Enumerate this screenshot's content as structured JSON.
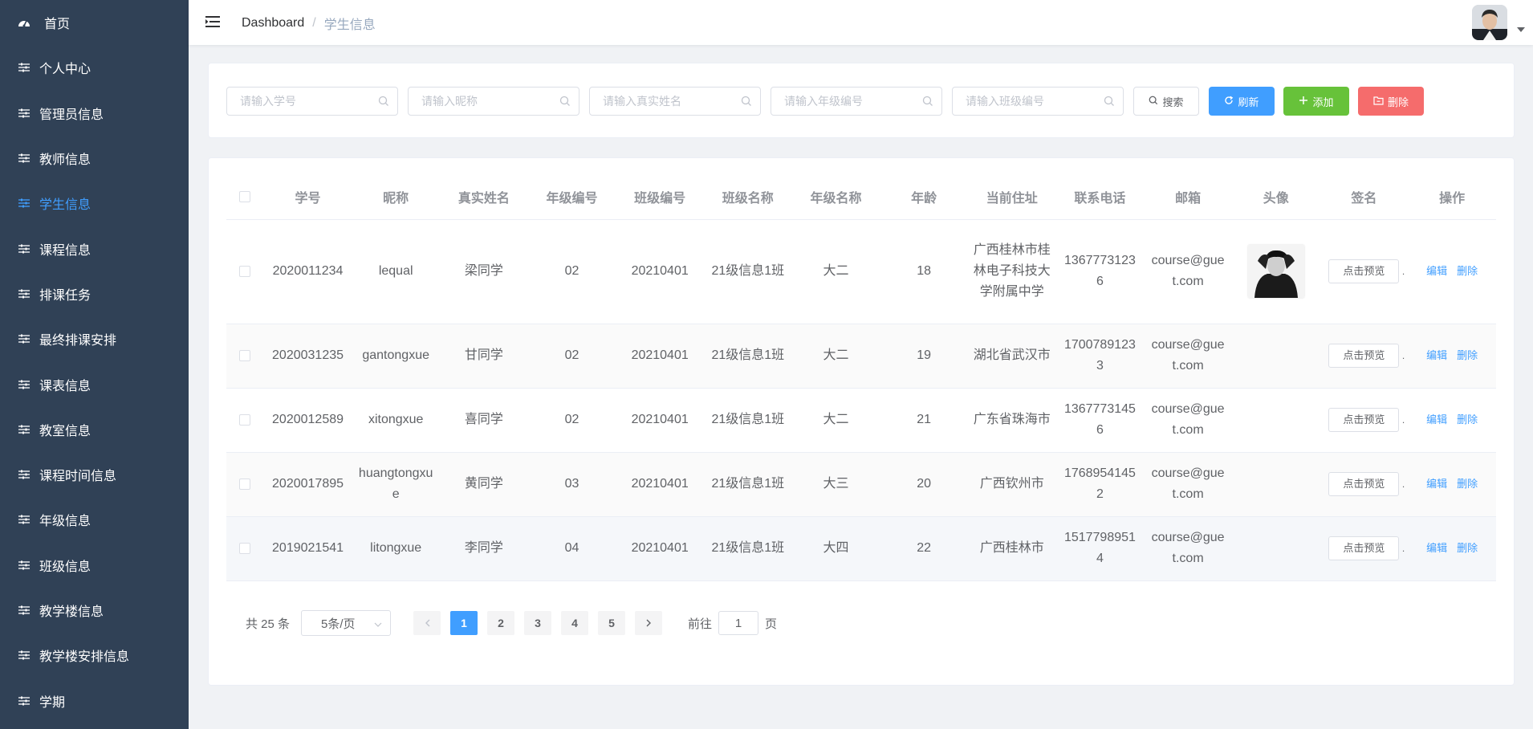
{
  "sidebar": {
    "items": [
      {
        "label": "首页",
        "icon": "dashboard-icon"
      },
      {
        "label": "个人中心",
        "icon": "sliders-icon"
      },
      {
        "label": "管理员信息",
        "icon": "sliders-icon"
      },
      {
        "label": "教师信息",
        "icon": "sliders-icon"
      },
      {
        "label": "学生信息",
        "icon": "sliders-icon",
        "active": true
      },
      {
        "label": "课程信息",
        "icon": "sliders-icon"
      },
      {
        "label": "排课任务",
        "icon": "sliders-icon"
      },
      {
        "label": "最终排课安排",
        "icon": "sliders-icon"
      },
      {
        "label": "课表信息",
        "icon": "sliders-icon"
      },
      {
        "label": "教室信息",
        "icon": "sliders-icon"
      },
      {
        "label": "课程时间信息",
        "icon": "sliders-icon"
      },
      {
        "label": "年级信息",
        "icon": "sliders-icon"
      },
      {
        "label": "班级信息",
        "icon": "sliders-icon"
      },
      {
        "label": "教学楼信息",
        "icon": "sliders-icon"
      },
      {
        "label": "教学楼安排信息",
        "icon": "sliders-icon"
      },
      {
        "label": "学期",
        "icon": "sliders-icon"
      }
    ],
    "active_color": "#409eff",
    "bg_color": "#304156"
  },
  "header": {
    "breadcrumb_home": "Dashboard",
    "breadcrumb_sep": "/",
    "breadcrumb_current": "学生信息"
  },
  "search": {
    "student_no_placeholder": "请输入学号",
    "nickname_placeholder": "请输入昵称",
    "realname_placeholder": "请输入真实姓名",
    "grade_no_placeholder": "请输入年级编号",
    "class_no_placeholder": "请输入班级编号",
    "search_label": "搜索",
    "refresh_label": "刷新",
    "add_label": "添加",
    "delete_label": "删除"
  },
  "table": {
    "headers": {
      "student_no": "学号",
      "nickname": "昵称",
      "real_name": "真实姓名",
      "grade_no": "年级编号",
      "class_no": "班级编号",
      "class_name": "班级名称",
      "grade_name": "年级名称",
      "age": "年龄",
      "address": "当前住址",
      "phone": "联系电话",
      "email": "邮箱",
      "avatar": "头像",
      "signature": "签名",
      "actions": "操作"
    },
    "preview_label": "点击预览",
    "edit_label": "编辑",
    "delete_label": "删除",
    "rows": [
      {
        "student_no": "2020011234",
        "nickname": "lequal",
        "real_name": "梁同学",
        "grade_no": "02",
        "class_no": "20210401",
        "class_name": "21级信息1班",
        "grade_name": "大二",
        "age": "18",
        "address": "广西桂林市桂林电子科技大学附属中学",
        "phone": "13677731236",
        "email": "course@guet.com",
        "has_avatar": true
      },
      {
        "student_no": "2020031235",
        "nickname": "gantongxue",
        "real_name": "甘同学",
        "grade_no": "02",
        "class_no": "20210401",
        "class_name": "21级信息1班",
        "grade_name": "大二",
        "age": "19",
        "address": "湖北省武汉市",
        "phone": "17007891233",
        "email": "course@guet.com",
        "has_avatar": false
      },
      {
        "student_no": "2020012589",
        "nickname": "xitongxue",
        "real_name": "喜同学",
        "grade_no": "02",
        "class_no": "20210401",
        "class_name": "21级信息1班",
        "grade_name": "大二",
        "age": "21",
        "address": "广东省珠海市",
        "phone": "13677731456",
        "email": "course@guet.com",
        "has_avatar": false
      },
      {
        "student_no": "2020017895",
        "nickname": "huangtongxue",
        "real_name": "黄同学",
        "grade_no": "03",
        "class_no": "20210401",
        "class_name": "21级信息1班",
        "grade_name": "大三",
        "age": "20",
        "address": "广西钦州市",
        "phone": "17689541452",
        "email": "course@guet.com",
        "has_avatar": false
      },
      {
        "student_no": "2019021541",
        "nickname": "litongxue",
        "real_name": "李同学",
        "grade_no": "04",
        "class_no": "20210401",
        "class_name": "21级信息1班",
        "grade_name": "大四",
        "age": "22",
        "address": "广西桂林市",
        "phone": "15177989514",
        "email": "course@guet.com",
        "has_avatar": false
      }
    ]
  },
  "pagination": {
    "total_text": "共 25 条",
    "page_size": "5条/页",
    "pages": [
      "1",
      "2",
      "3",
      "4",
      "5"
    ],
    "current_page": "1",
    "goto_prefix": "前往",
    "goto_value": "1",
    "goto_suffix": "页"
  }
}
